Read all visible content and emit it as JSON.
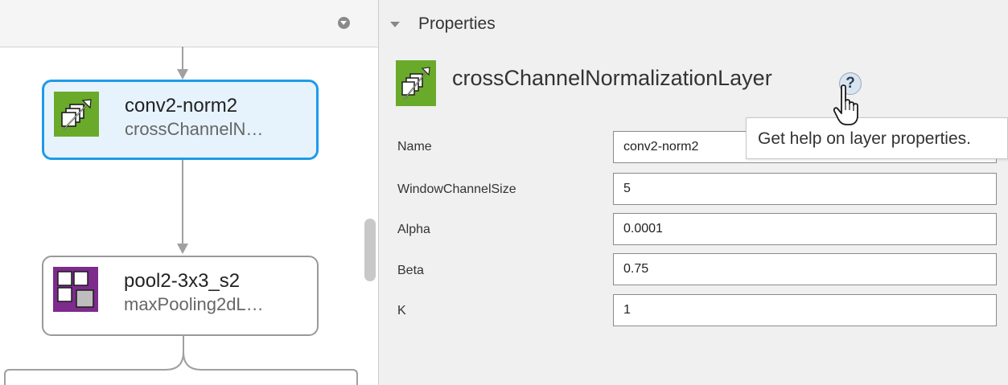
{
  "properties_panel": {
    "title": "Properties",
    "layer_type": "crossChannelNormalizationLayer",
    "help_glyph": "?",
    "help_tooltip": "Get help on layer properties.",
    "fields": [
      {
        "label": "Name",
        "value": "conv2-norm2"
      },
      {
        "label": "WindowChannelSize",
        "value": "5"
      },
      {
        "label": "Alpha",
        "value": "0.0001"
      },
      {
        "label": "Beta",
        "value": "0.75"
      },
      {
        "label": "K",
        "value": "1"
      }
    ]
  },
  "network": {
    "nodes": [
      {
        "name": "conv2-norm2",
        "type": "crossChannelN…",
        "icon": "cross-channel-normalization-icon",
        "selected": true,
        "icon_color": "#6aaa2b"
      },
      {
        "name": "pool2-3x3_s2",
        "type": "maxPooling2dL…",
        "icon": "max-pooling-icon",
        "selected": false,
        "icon_color": "#7d2b8c"
      }
    ]
  },
  "colors": {
    "selection": "#1e9be8",
    "selected_background": "#e6f3fc",
    "normalization_icon": "#6aaa2b",
    "pooling_icon": "#7d2b8c"
  }
}
